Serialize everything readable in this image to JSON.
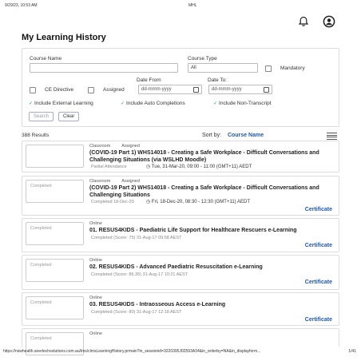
{
  "print": {
    "timestamp": "9/29/23, 10:53 AM",
    "app": "MHL",
    "url": "https://nswhealth.seertechsolutions.com.au/lms/clmsLearningHistory.prmain?in_sessionid=3220395J02593A34&in_orderby=NA&in_displayform...",
    "page": "1/41"
  },
  "header": {
    "bell_icon": "bell-icon",
    "user_icon": "user-circle-icon"
  },
  "page_title": "My Learning History",
  "filters": {
    "course_name_label": "Course Name",
    "course_name_value": "",
    "course_type_label": "Course Type",
    "course_type_value": "All",
    "mandatory_label": "Mandatory",
    "ce_directive_label": "CE Directive",
    "assigned_label": "Assigned",
    "date_from_label": "Date From",
    "date_from_placeholder": "dd-mmm-yyyy",
    "date_to_label": "Date To:",
    "date_to_placeholder": "dd-mmm-yyyy",
    "include_external": "Include External Learning",
    "include_auto": "Include Auto Completions",
    "include_non_transcript": "Include Non-Transcript",
    "search_label": "Search",
    "clear_label": "Clear"
  },
  "results": {
    "count": "388 Results",
    "sort_label": "Sort by:",
    "sort_value": "Course Name"
  },
  "items": [
    {
      "thumb": "",
      "type": "Classroom",
      "assigned": "Assigned",
      "title": "(COVID-19 Part 1) WHS14018 - Creating a Safe Workplace - Difficult Conversations and Challenging Situations (via WSLHD Moodle)",
      "status": "Partial Attendance",
      "date": "Tue, 31-Mar-20, 09:00 - 11:00 (GMT+11) AEDT",
      "cert": ""
    },
    {
      "thumb": "Completed",
      "type": "Classroom",
      "assigned": "Assigned",
      "title": "(COVID-19 Part 2) WHS14018 - Creating a Safe Workplace - Difficult Conversations and Challenging Situations",
      "status": "Completed 18-Dec-20",
      "date": "Fri, 18-Dec-20, 08:30 - 12:30 (GMT+11) AEDT",
      "cert": "Certificate"
    },
    {
      "thumb": "Completed",
      "type": "Online",
      "title": "01. RESUS4KIDS - Paediatric Life Support for Healthcare Rescuers e-Learning",
      "status": "Completed (Score: 75) 31-Aug-17 09:58 AEST",
      "cert": "Certificate"
    },
    {
      "thumb": "Completed",
      "type": "Online",
      "title": "02. RESUS4KIDS - Advanced Paediatric Resuscitation e-Learning",
      "status": "Completed (Score: 86.36) 31-Aug-17 10:21 AEST",
      "cert": "Certificate"
    },
    {
      "thumb": "Completed",
      "type": "Online",
      "title": "03. RESUS4KIDS - Intraosseous Access e-Learning",
      "status": "Completed (Score: 80) 31-Aug-17 12:18 AEST",
      "cert": "Certificate"
    },
    {
      "thumb": "Completed",
      "type": "Online"
    }
  ],
  "colors": {
    "link": "#1f5aa8",
    "check": "#22aa66"
  }
}
